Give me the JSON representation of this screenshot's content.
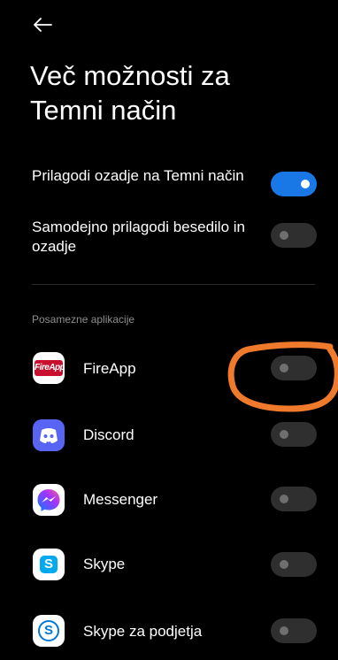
{
  "header": {
    "back_icon": "arrow-left-icon",
    "title_line1": "Več možnosti za",
    "title_line2": "Temni način"
  },
  "settings": [
    {
      "label": "Prilagodi ozadje na Temni način",
      "enabled": true
    },
    {
      "label": "Samodejno prilagodi besedilo in ozadje",
      "enabled": false
    }
  ],
  "section_title": "Posamezne aplikacije",
  "apps": [
    {
      "name": "FireApp",
      "icon": "fireapp-icon",
      "icon_text": "FireApp",
      "enabled": false
    },
    {
      "name": "Discord",
      "icon": "discord-icon",
      "enabled": false
    },
    {
      "name": "Messenger",
      "icon": "messenger-icon",
      "enabled": false
    },
    {
      "name": "Skype",
      "icon": "skype-icon",
      "enabled": false
    },
    {
      "name": "Skype za podjetja",
      "icon": "skype-business-icon",
      "enabled": false
    }
  ],
  "colors": {
    "accent": "#1a78e6",
    "annotation": "#f07a2b",
    "background": "#000000"
  }
}
